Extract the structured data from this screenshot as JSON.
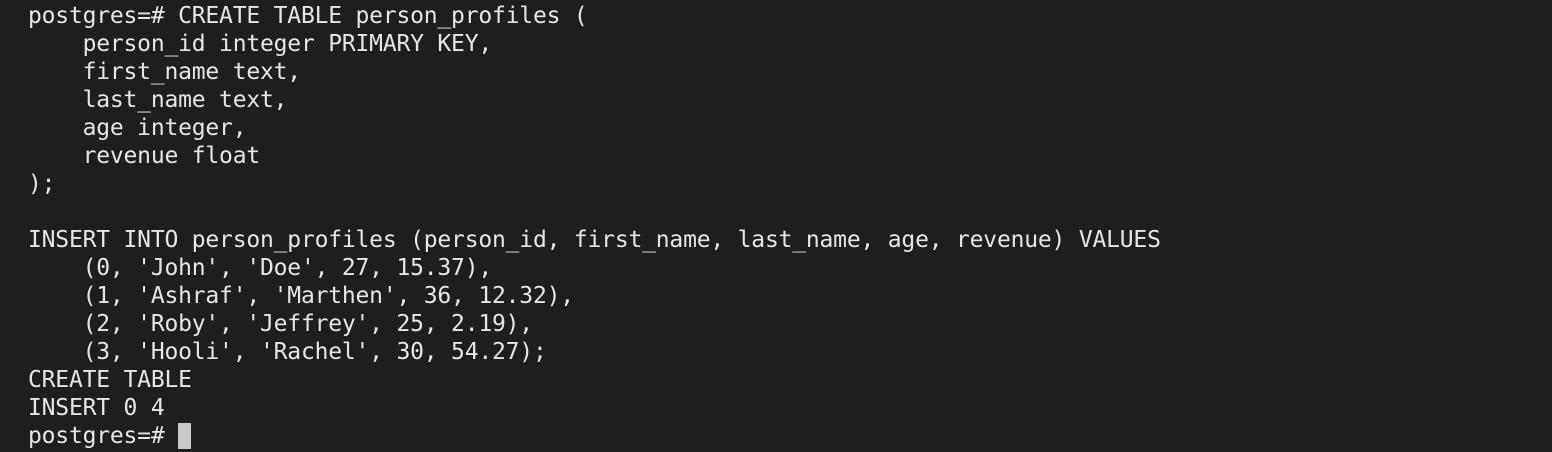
{
  "terminal": {
    "lines": [
      "postgres=# CREATE TABLE person_profiles (",
      "    person_id integer PRIMARY KEY,",
      "    first_name text,",
      "    last_name text,",
      "    age integer,",
      "    revenue float",
      ");",
      "",
      "INSERT INTO person_profiles (person_id, first_name, last_name, age, revenue) VALUES",
      "    (0, 'John', 'Doe', 27, 15.37),",
      "    (1, 'Ashraf', 'Marthen', 36, 12.32),",
      "    (2, 'Roby', 'Jeffrey', 25, 2.19),",
      "    (3, 'Hooli', 'Rachel', 30, 54.27);",
      "CREATE TABLE",
      "INSERT 0 4"
    ],
    "prompt": "postgres=# ",
    "colors": {
      "background": "#1e1e1e",
      "text": "#e6e6e6",
      "cursor": "#c8c8c8"
    }
  }
}
